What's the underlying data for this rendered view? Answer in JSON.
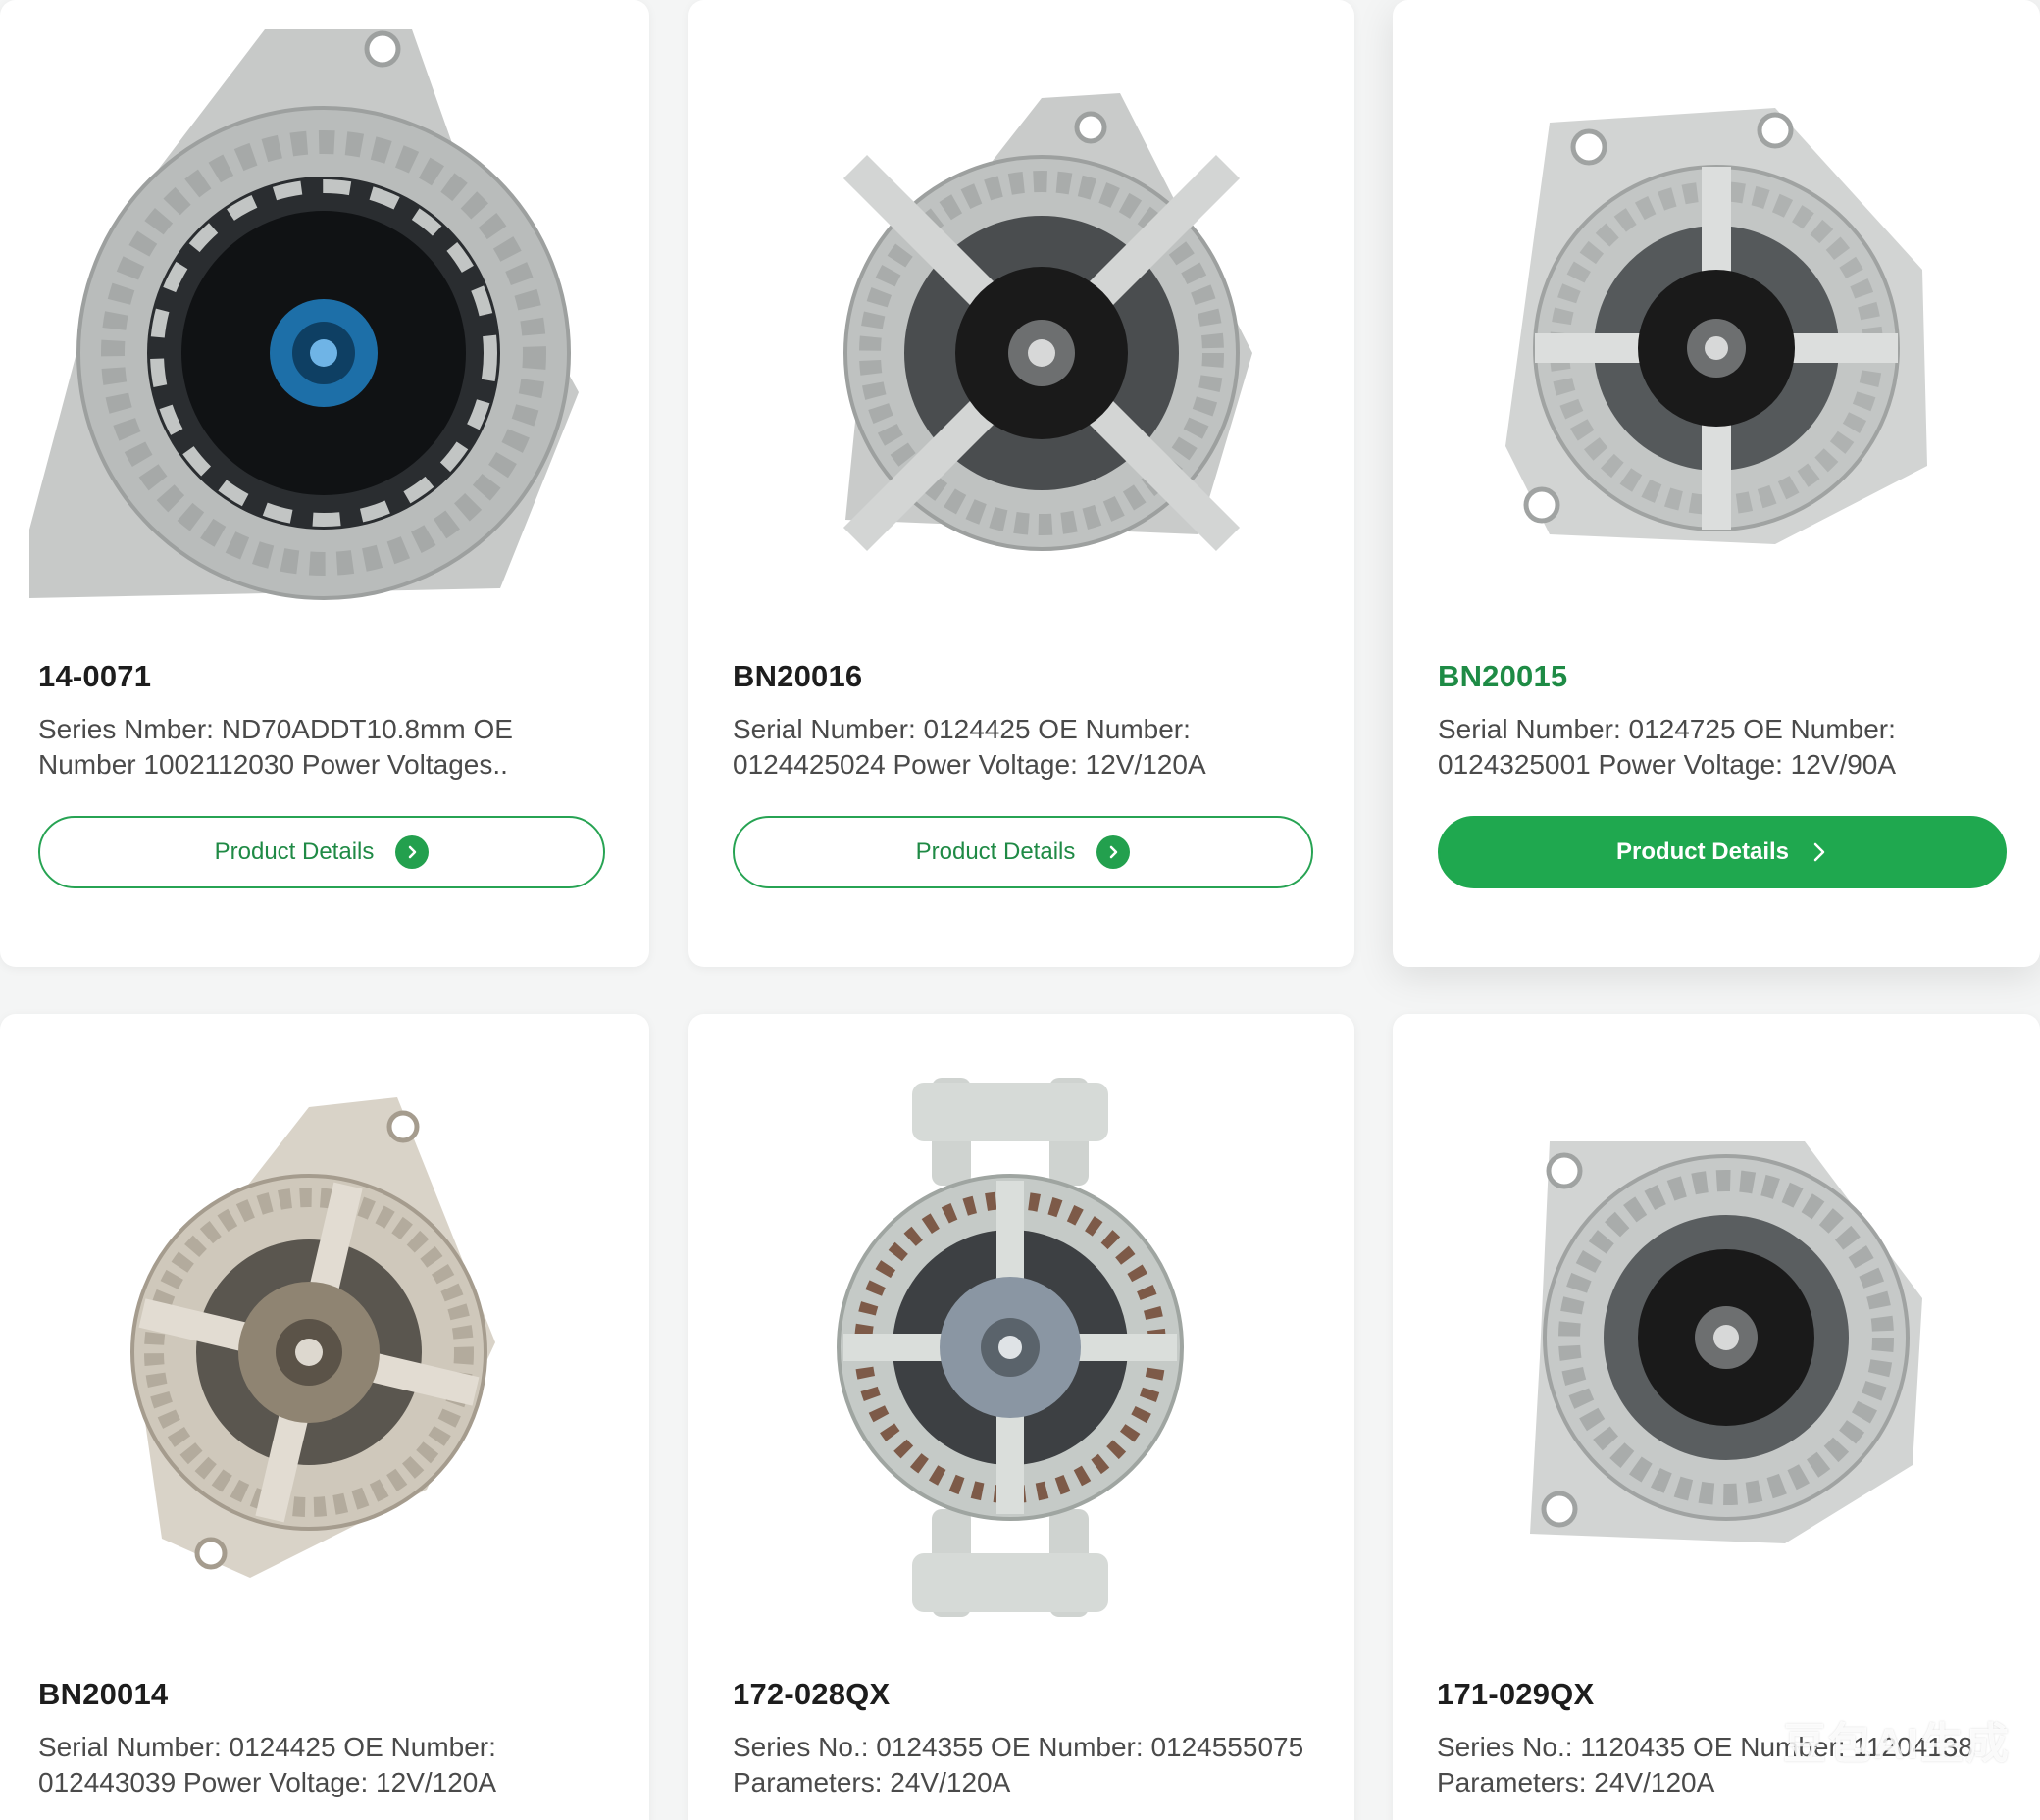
{
  "products": [
    {
      "code": "14-0071",
      "desc": "Series Nmber: ND70ADDT10.8mm OE Number 1002112030 Power Voltages..",
      "button_label": "Product Details",
      "image": "alternator-product-photo",
      "hub_color": "#1d6fa8"
    },
    {
      "code": "BN20016",
      "desc": "Serial Number: 0124425 OE Number: 0124425024 Power Voltage: 12V/120A",
      "button_label": "Product Details",
      "image": "alternator-product-photo",
      "hub_color": "#1a1a1a"
    },
    {
      "code": "BN20015",
      "desc": "Serial Number: 0124725 OE Number: 0124325001 Power Voltage: 12V/90A",
      "button_label": "Product Details",
      "image": "alternator-product-photo",
      "hub_color": "#1a1a1a"
    },
    {
      "code": "BN20014",
      "desc": "Serial Number: 0124425 OE Number: 012443039 Power Voltage: 12V/120A",
      "image": "alternator-product-photo",
      "hub_color": "#8f8472"
    },
    {
      "code": "172-028QX",
      "desc": "Series No.: 0124355 OE Number: 0124555075 Parameters: 24V/120A",
      "image": "alternator-product-photo",
      "hub_color": "#8a96a3"
    },
    {
      "code": "171-029QX",
      "desc": "Series No.: 1120435 OE Number: 11204138 Parameters: 24V/120A",
      "image": "alternator-product-photo",
      "hub_color": "#1a1a1a"
    }
  ],
  "watermark": "豆包AI生成",
  "colors": {
    "accent": "#1fa84f",
    "accent_text": "#1e8b45",
    "title": "#1d1d1d",
    "body_text": "#4a4a4a",
    "background": "#f4f5f5",
    "card": "#ffffff"
  }
}
